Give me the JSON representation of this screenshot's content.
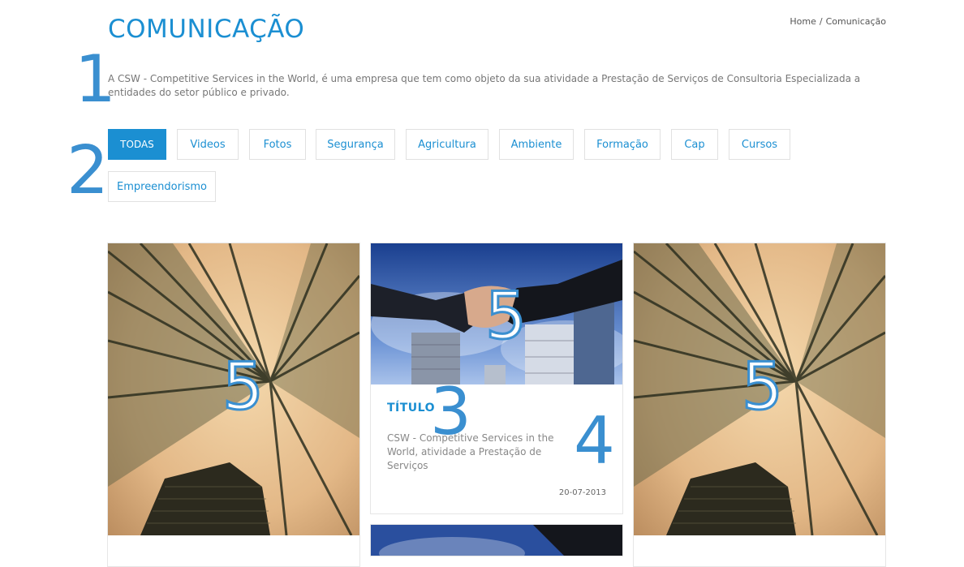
{
  "header": {
    "title": "COMUNICAÇÃO",
    "breadcrumb": [
      "Home",
      "Comunicação"
    ],
    "breadcrumb_separator": "/"
  },
  "intro": "A CSW - Competitive Services in the World, é uma empresa que tem como objeto da sua atividade a Prestação de Serviços de Consultoria Especializada a entidades do setor público e privado.",
  "filters": [
    "TODAS",
    "Videos",
    "Fotos",
    "Segurança",
    "Agricultura",
    "Ambiente",
    "Formação",
    "Cap",
    "Cursos",
    "Empreendorismo"
  ],
  "active_filter": "TODAS",
  "annotations": [
    "1",
    "2",
    "3",
    "4",
    "5"
  ],
  "cards": {
    "featured": {
      "title": "TÍTULO",
      "text": "CSW - Competitive Services in the World, atividade a Prestação de Serviços",
      "date": "20-07-2013"
    }
  },
  "colors": {
    "accent": "#1b8fd2",
    "annotation": "#3a8fd0",
    "border": "#e1e1e1"
  }
}
